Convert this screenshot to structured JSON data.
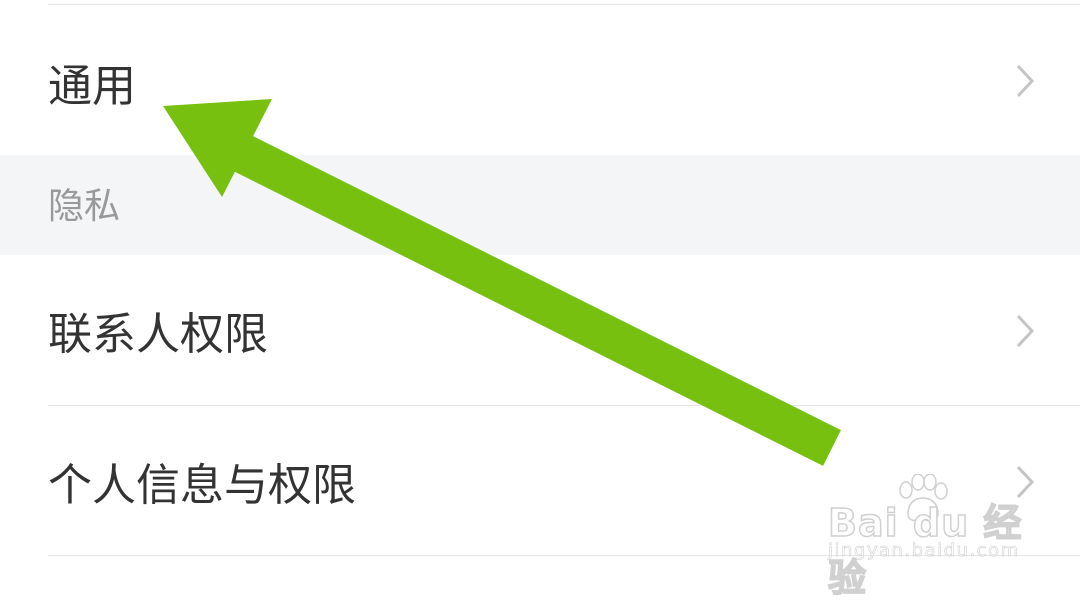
{
  "settings": {
    "general_label": "通用",
    "privacy_section_label": "隐私",
    "contacts_permission_label": "联系人权限",
    "personal_info_label": "个人信息与权限"
  },
  "annotation": {
    "arrow_color": "#77c00f"
  },
  "watermark": {
    "brand": "Bai du 经验",
    "url": "jingyan.baidu.com"
  }
}
